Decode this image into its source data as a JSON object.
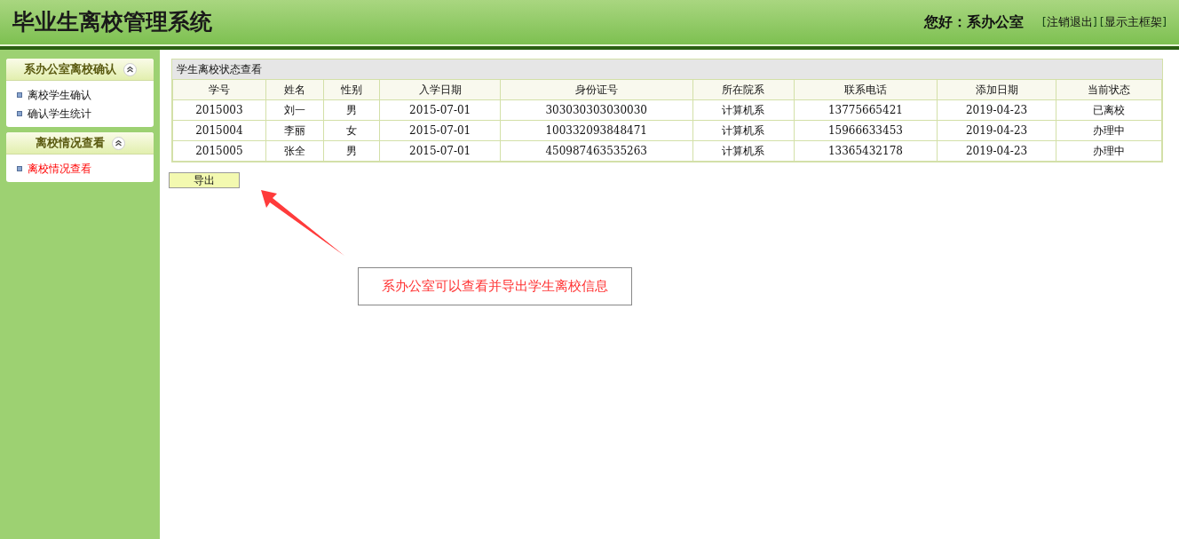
{
  "header": {
    "title": "毕业生离校管理系统",
    "greeting": "您好：系办公室",
    "links": [
      {
        "bracket_open": "[",
        "label": "注销退出",
        "bracket_close": "]"
      },
      {
        "bracket_open": "[",
        "label": "显示主框架",
        "bracket_close": "]"
      }
    ]
  },
  "sidebar": {
    "sections": [
      {
        "title": "系办公室离校确认",
        "expanded": true,
        "items": [
          {
            "label": "离校学生确认",
            "selected": false
          },
          {
            "label": "确认学生统计",
            "selected": false
          }
        ]
      },
      {
        "title": "离校情况查看",
        "expanded": true,
        "items": [
          {
            "label": "离校情况查看",
            "selected": true
          }
        ]
      }
    ]
  },
  "table": {
    "caption": "学生离校状态查看",
    "columns": [
      "学号",
      "姓名",
      "性别",
      "入学日期",
      "身份证号",
      "所在院系",
      "联系电话",
      "添加日期",
      "当前状态"
    ],
    "rows": [
      [
        "2015003",
        "刘一",
        "男",
        "2015-07-01",
        "303030303030030",
        "计算机系",
        "13775665421",
        "2019-04-23",
        "已离校"
      ],
      [
        "2015004",
        "李丽",
        "女",
        "2015-07-01",
        "100332093848471",
        "计算机系",
        "15966633453",
        "2019-04-23",
        "办理中"
      ],
      [
        "2015005",
        "张全",
        "男",
        "2015-07-01",
        "450987463535263",
        "计算机系",
        "13365432178",
        "2019-04-23",
        "办理中"
      ]
    ]
  },
  "export_button": "导出",
  "annotation": {
    "text": "系办公室可以查看并导出学生离校信息"
  }
}
